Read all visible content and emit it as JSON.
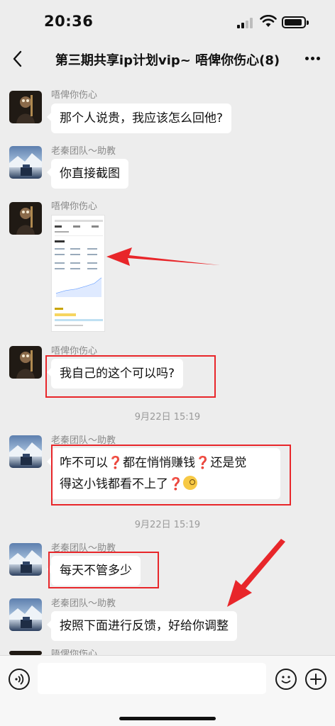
{
  "status_bar": {
    "time": "20:36"
  },
  "nav": {
    "title": "第三期共享ip计划vip~ 唔俾你伤心(8)"
  },
  "messages": [
    {
      "sender": "唔俾你伤心",
      "text": "那个人说贵，我应该怎么回他?"
    },
    {
      "sender": "老秦团队～助教",
      "text": "你直接截图"
    },
    {
      "sender": "唔俾你伤心",
      "type": "image"
    },
    {
      "sender": "唔俾你伤心",
      "text": "我自己的这个可以吗?"
    },
    {
      "timestamp": "9月22日 15:19"
    },
    {
      "sender": "老秦团队～助教",
      "line1_a": "咋不可以",
      "line1_b": "都在悄悄赚钱",
      "line1_c": "还是觉",
      "line2": "得这小钱都看不上了",
      "q": "❓"
    },
    {
      "timestamp": "9月22日 15:19"
    },
    {
      "sender": "老秦团队～助教",
      "text": "每天不管多少"
    },
    {
      "sender": "老秦团队～助教",
      "text": "按照下面进行反馈，好给你调整"
    },
    {
      "sender": "唔俾你伤心"
    }
  ],
  "colors": {
    "annotation_red": "#e8262a",
    "background": "#ededed",
    "bubble": "#ffffff"
  },
  "icons": [
    "back-icon",
    "more-icon",
    "voice-icon",
    "emoji-icon",
    "plus-icon",
    "signal-icon",
    "wifi-icon",
    "battery-icon"
  ]
}
